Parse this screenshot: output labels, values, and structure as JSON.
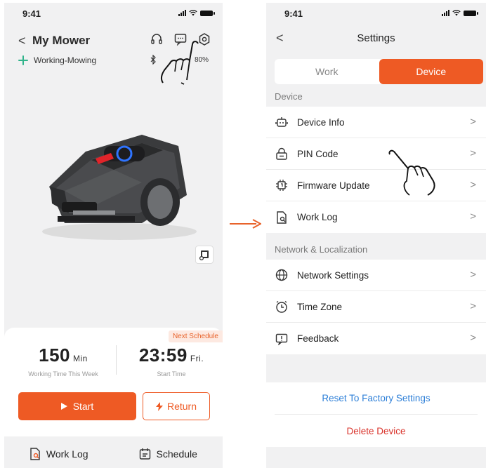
{
  "left_screen": {
    "status": {
      "time": "9:41"
    },
    "header": {
      "back": "<",
      "title": "My Mower"
    },
    "icons": [
      "headset-icon",
      "message-icon",
      "settings-icon"
    ],
    "status_text": "Working-Mowing",
    "battery_text": "80%",
    "schedule_badge": "Next Schedule",
    "stats": {
      "work_value": "150",
      "work_unit": "Min",
      "work_caption": "Working Time This Week",
      "start_value": "23:59",
      "start_unit": "Fri.",
      "start_caption": "Start Time"
    },
    "buttons": {
      "start": "Start",
      "return": "Return"
    },
    "bottom_bar": {
      "work_log": "Work Log",
      "schedule": "Schedule"
    }
  },
  "right_screen": {
    "status": {
      "time": "9:41"
    },
    "header": {
      "back": "<",
      "title": "Settings"
    },
    "tabs": [
      {
        "label": "Work",
        "active": false
      },
      {
        "label": "Device",
        "active": true
      }
    ],
    "device_section": {
      "label": "Device",
      "items": [
        {
          "label": "Device Info",
          "icon": "robot-icon"
        },
        {
          "label": "PIN Code",
          "icon": "lock-icon"
        },
        {
          "label": "Firmware Update",
          "icon": "chip-icon"
        },
        {
          "label": "Work Log",
          "icon": "log-icon"
        }
      ]
    },
    "network_section": {
      "label": "Network & Localization",
      "items": [
        {
          "label": "Network Settings",
          "icon": "globe-icon"
        },
        {
          "label": "Time Zone",
          "icon": "clock-icon"
        },
        {
          "label": "Feedback",
          "icon": "feedback-icon"
        }
      ]
    },
    "actions": {
      "reset": "Reset To Factory Settings",
      "delete": "Delete Device"
    }
  },
  "colors": {
    "accent": "#ee5a24",
    "link": "#2f80d8",
    "danger": "#d9332b",
    "status_green": "#2fb38a"
  }
}
